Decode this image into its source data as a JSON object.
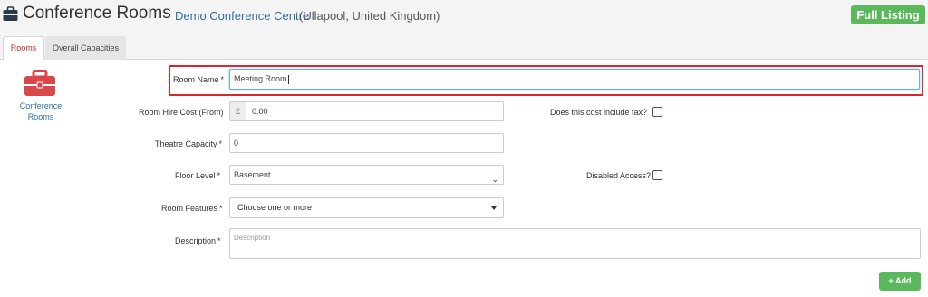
{
  "header": {
    "title": "Conference Rooms",
    "venue_link": "Demo Conference Centre",
    "venue_location": "(Ullapool, United Kingdom)",
    "full_listing_label": "Full Listing"
  },
  "tabs": [
    {
      "label": "Rooms",
      "active": true
    },
    {
      "label": "Overall Capacities",
      "active": false
    }
  ],
  "sidebar": {
    "label": "Conference Rooms",
    "icon": "briefcase-icon"
  },
  "form": {
    "room_name": {
      "label": "Room Name",
      "required": "*",
      "value": "Meeting Room"
    },
    "room_hire_cost": {
      "label": "Room Hire Cost (From)",
      "currency": "£",
      "value": "0.00"
    },
    "tax": {
      "label": "Does this cost include tax?",
      "checked": false
    },
    "theatre_capacity": {
      "label": "Theatre Capacity",
      "required": "*",
      "value": "0"
    },
    "floor_level": {
      "label": "Floor Level",
      "required": "*",
      "value": "Basement"
    },
    "disabled_access": {
      "label": "Disabled Access?",
      "checked": false
    },
    "room_features": {
      "label": "Room Features",
      "required": "*",
      "placeholder": "Choose one or more"
    },
    "description": {
      "label": "Description",
      "required": "*",
      "placeholder": "Description"
    }
  },
  "add_button": {
    "icon": "+",
    "label": "Add"
  },
  "colors": {
    "accent_green": "#5cb85c",
    "link_blue": "#2f6fa8",
    "tab_active": "#c9302c",
    "highlight_red": "#d9262c",
    "briefcase_red": "#d9464c"
  }
}
